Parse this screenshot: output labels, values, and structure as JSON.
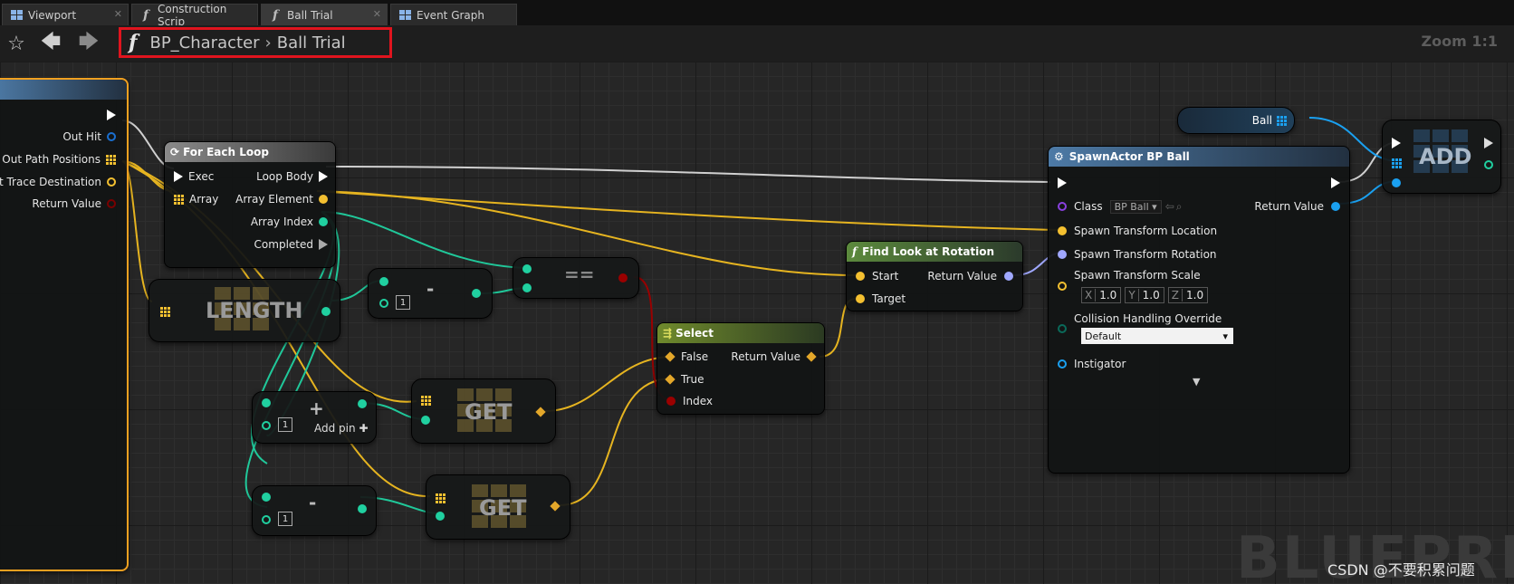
{
  "tabs": [
    {
      "label": "Viewport",
      "icon": "viewport-icon"
    },
    {
      "label": "Construction Scrip",
      "icon": "function-icon"
    },
    {
      "label": "Ball Trial",
      "icon": "function-icon",
      "active": true
    },
    {
      "label": "Event Graph",
      "icon": "event-graph-icon"
    }
  ],
  "toolbar": {
    "breadcrumb_root": "BP_Character",
    "breadcrumb_current": "Ball Trial",
    "zoom": "Zoom 1:1"
  },
  "entry_node": {
    "pins": [
      "Out Hit",
      "Out Path Positions",
      "st Trace Destination",
      "Return Value"
    ]
  },
  "foreach_node": {
    "title": "For Each Loop",
    "in_exec": "Exec",
    "in_array": "Array",
    "out_loop_body": "Loop Body",
    "out_element": "Array Element",
    "out_index": "Array Index",
    "out_completed": "Completed"
  },
  "length_node": {
    "label": "LENGTH"
  },
  "minus_node_1": {
    "op": "-",
    "value": "1"
  },
  "equal_node": {
    "op": "=="
  },
  "add_int_node": {
    "op": "+",
    "value": "1",
    "add_pin": "Add pin"
  },
  "minus_node_2": {
    "op": "-",
    "value": "1"
  },
  "get_node_1": {
    "label": "GET"
  },
  "get_node_2": {
    "label": "GET"
  },
  "select_node": {
    "title": "Select",
    "in_false": "False",
    "in_true": "True",
    "in_index": "Index",
    "out_return": "Return Value"
  },
  "look_at_node": {
    "title": "Find Look at Rotation",
    "in_start": "Start",
    "in_target": "Target",
    "out_return": "Return Value"
  },
  "spawn_node": {
    "title": "SpawnActor BP Ball",
    "class_label": "Class",
    "class_value": "BP Ball",
    "location": "Spawn Transform Location",
    "rotation": "Spawn Transform Rotation",
    "scale": "Spawn Transform Scale",
    "scale_x_label": "X",
    "scale_x": "1.0",
    "scale_y_label": "Y",
    "scale_y": "1.0",
    "scale_z_label": "Z",
    "scale_z": "1.0",
    "collision": "Collision Handling Override",
    "collision_value": "Default",
    "instigator": "Instigator",
    "out_return": "Return Value"
  },
  "ball_var_node": {
    "label": "Ball"
  },
  "add_node": {
    "label": "ADD"
  },
  "watermark": "BLUEPRINT",
  "csdn_credit": "CSDN @不要积累问题",
  "colors": {
    "exec": "#ffffff",
    "vector": "#f4c030",
    "rotator": "#a0a8ff",
    "integer": "#20d0a0",
    "boolean": "#9a0000",
    "object": "#00a8f4",
    "wildcard": "#e3a72a",
    "highlight": "#e0141e"
  }
}
